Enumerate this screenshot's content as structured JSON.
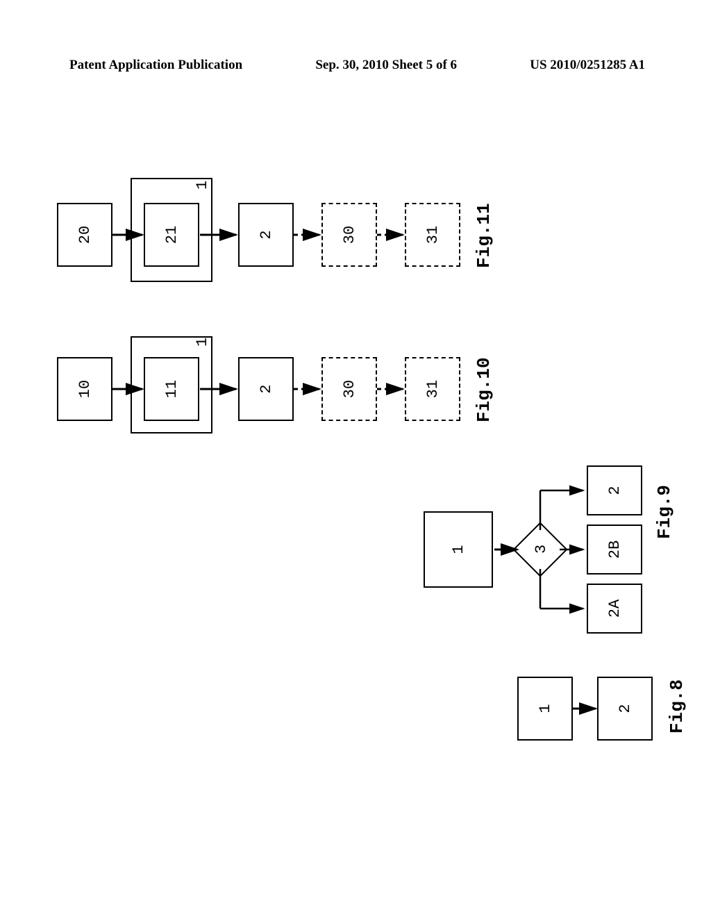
{
  "header": {
    "left": "Patent Application Publication",
    "center": "Sep. 30, 2010  Sheet 5 of 6",
    "right": "US 2010/0251285 A1"
  },
  "fig8": {
    "label": "Fig.8",
    "box1": "1",
    "box2": "2"
  },
  "fig9": {
    "label": "Fig.9",
    "box1": "1",
    "diamond": "3",
    "box2a": "2A",
    "box2b": "2B",
    "box2": "2"
  },
  "fig10": {
    "label": "Fig.10",
    "box10": "10",
    "box11": "11",
    "container": "1",
    "box2": "2",
    "box30": "30",
    "box31": "31"
  },
  "fig11": {
    "label": "Fig.11",
    "box20": "20",
    "box21": "21",
    "container": "1",
    "box2": "2",
    "box30": "30",
    "box31": "31"
  }
}
